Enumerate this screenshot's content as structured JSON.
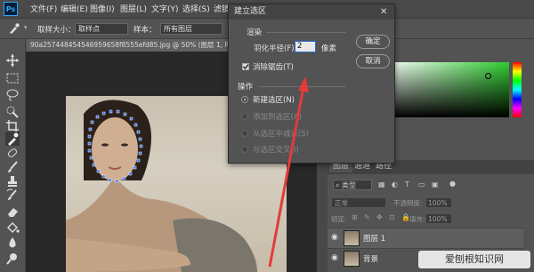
{
  "app": {
    "logo": "Ps"
  },
  "menubar": {
    "items": [
      "文件(F)",
      "编辑(E)",
      "图像(I)",
      "图层(L)",
      "文字(Y)",
      "选择(S)",
      "滤镜"
    ]
  },
  "options": {
    "sample_size_label": "取样大小：",
    "sample_size_value": "取样点",
    "sample_label": "样本：",
    "sample_value": "所有图层"
  },
  "document": {
    "tab_title": "90a257448454546959658f8555efd85.jpg @ 50% (图层 1, RGB/8)"
  },
  "dialog": {
    "title": "建立选区",
    "render_group": "渲染",
    "feather_label": "羽化半径(F):",
    "feather_value": "2",
    "feather_unit": "像素",
    "antialias_label": "消除锯齿(T)",
    "antialias_checked": true,
    "ok_label": "确定",
    "cancel_label": "取消",
    "operation_group": "操作",
    "operations": [
      {
        "label": "新建选区(N)",
        "selected": true,
        "enabled": true
      },
      {
        "label": "添加到选区(A)",
        "selected": false,
        "enabled": false
      },
      {
        "label": "从选区中减去(S)",
        "selected": false,
        "enabled": false
      },
      {
        "label": "与选区交叉(I)",
        "selected": false,
        "enabled": false
      }
    ]
  },
  "layers_panel": {
    "tabs": [
      "图层",
      "通道",
      "路径"
    ],
    "kind_label": "类型",
    "blend_mode": "正常",
    "opacity_label": "不透明度:",
    "opacity_value": "100%",
    "lock_label": "锁定:",
    "fill_label": "填充:",
    "fill_value": "100%",
    "layers": [
      {
        "name": "图层 1"
      },
      {
        "name": "背景"
      }
    ]
  },
  "watermark": {
    "text": "爱刨根知识网"
  },
  "colors": {
    "accent": "#31a8ff",
    "selection_dots": "#2f6bff",
    "arrow": "#e33b3b"
  }
}
